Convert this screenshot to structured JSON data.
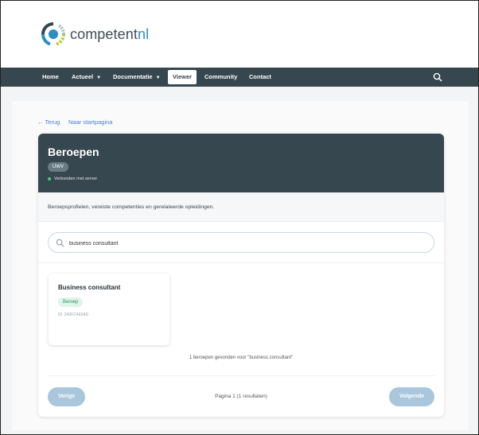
{
  "logo": {
    "text_main": "competent",
    "text_accent": "nl"
  },
  "nav": {
    "items": [
      {
        "label": "Home"
      },
      {
        "label": "Actueel",
        "chevron": "⌄"
      },
      {
        "label": "Documentatie",
        "chevron": "⌄"
      },
      {
        "label": "Viewer",
        "active": true
      },
      {
        "label": "Community"
      },
      {
        "label": "Contact"
      }
    ],
    "search_icon": "search-icon"
  },
  "links": {
    "back": "← Terug",
    "home": "Naar startpagina"
  },
  "panel": {
    "title": "Beroepen",
    "badge": "UWV",
    "connection_status": "Verbonden met server",
    "status_color": "#44d07b",
    "description": "Beroepsprofielen, vereiste competenties en gerelateerde opleidingen."
  },
  "search": {
    "value": "business consultant",
    "placeholder": ""
  },
  "results": [
    {
      "title": "Business consultant",
      "type": "Beroep",
      "id": "ID: 240FC4E54D"
    }
  ],
  "found_text": "1 beroepen gevonden voor \"business consultant\"",
  "pagination": {
    "prev": "Vorige",
    "info": "Pagina 1 (1 resultaten)",
    "next": "Volgende"
  },
  "colors": {
    "header_bg": "#37474f",
    "accent": "#2e8fbf",
    "button": "#a9c6dc"
  }
}
